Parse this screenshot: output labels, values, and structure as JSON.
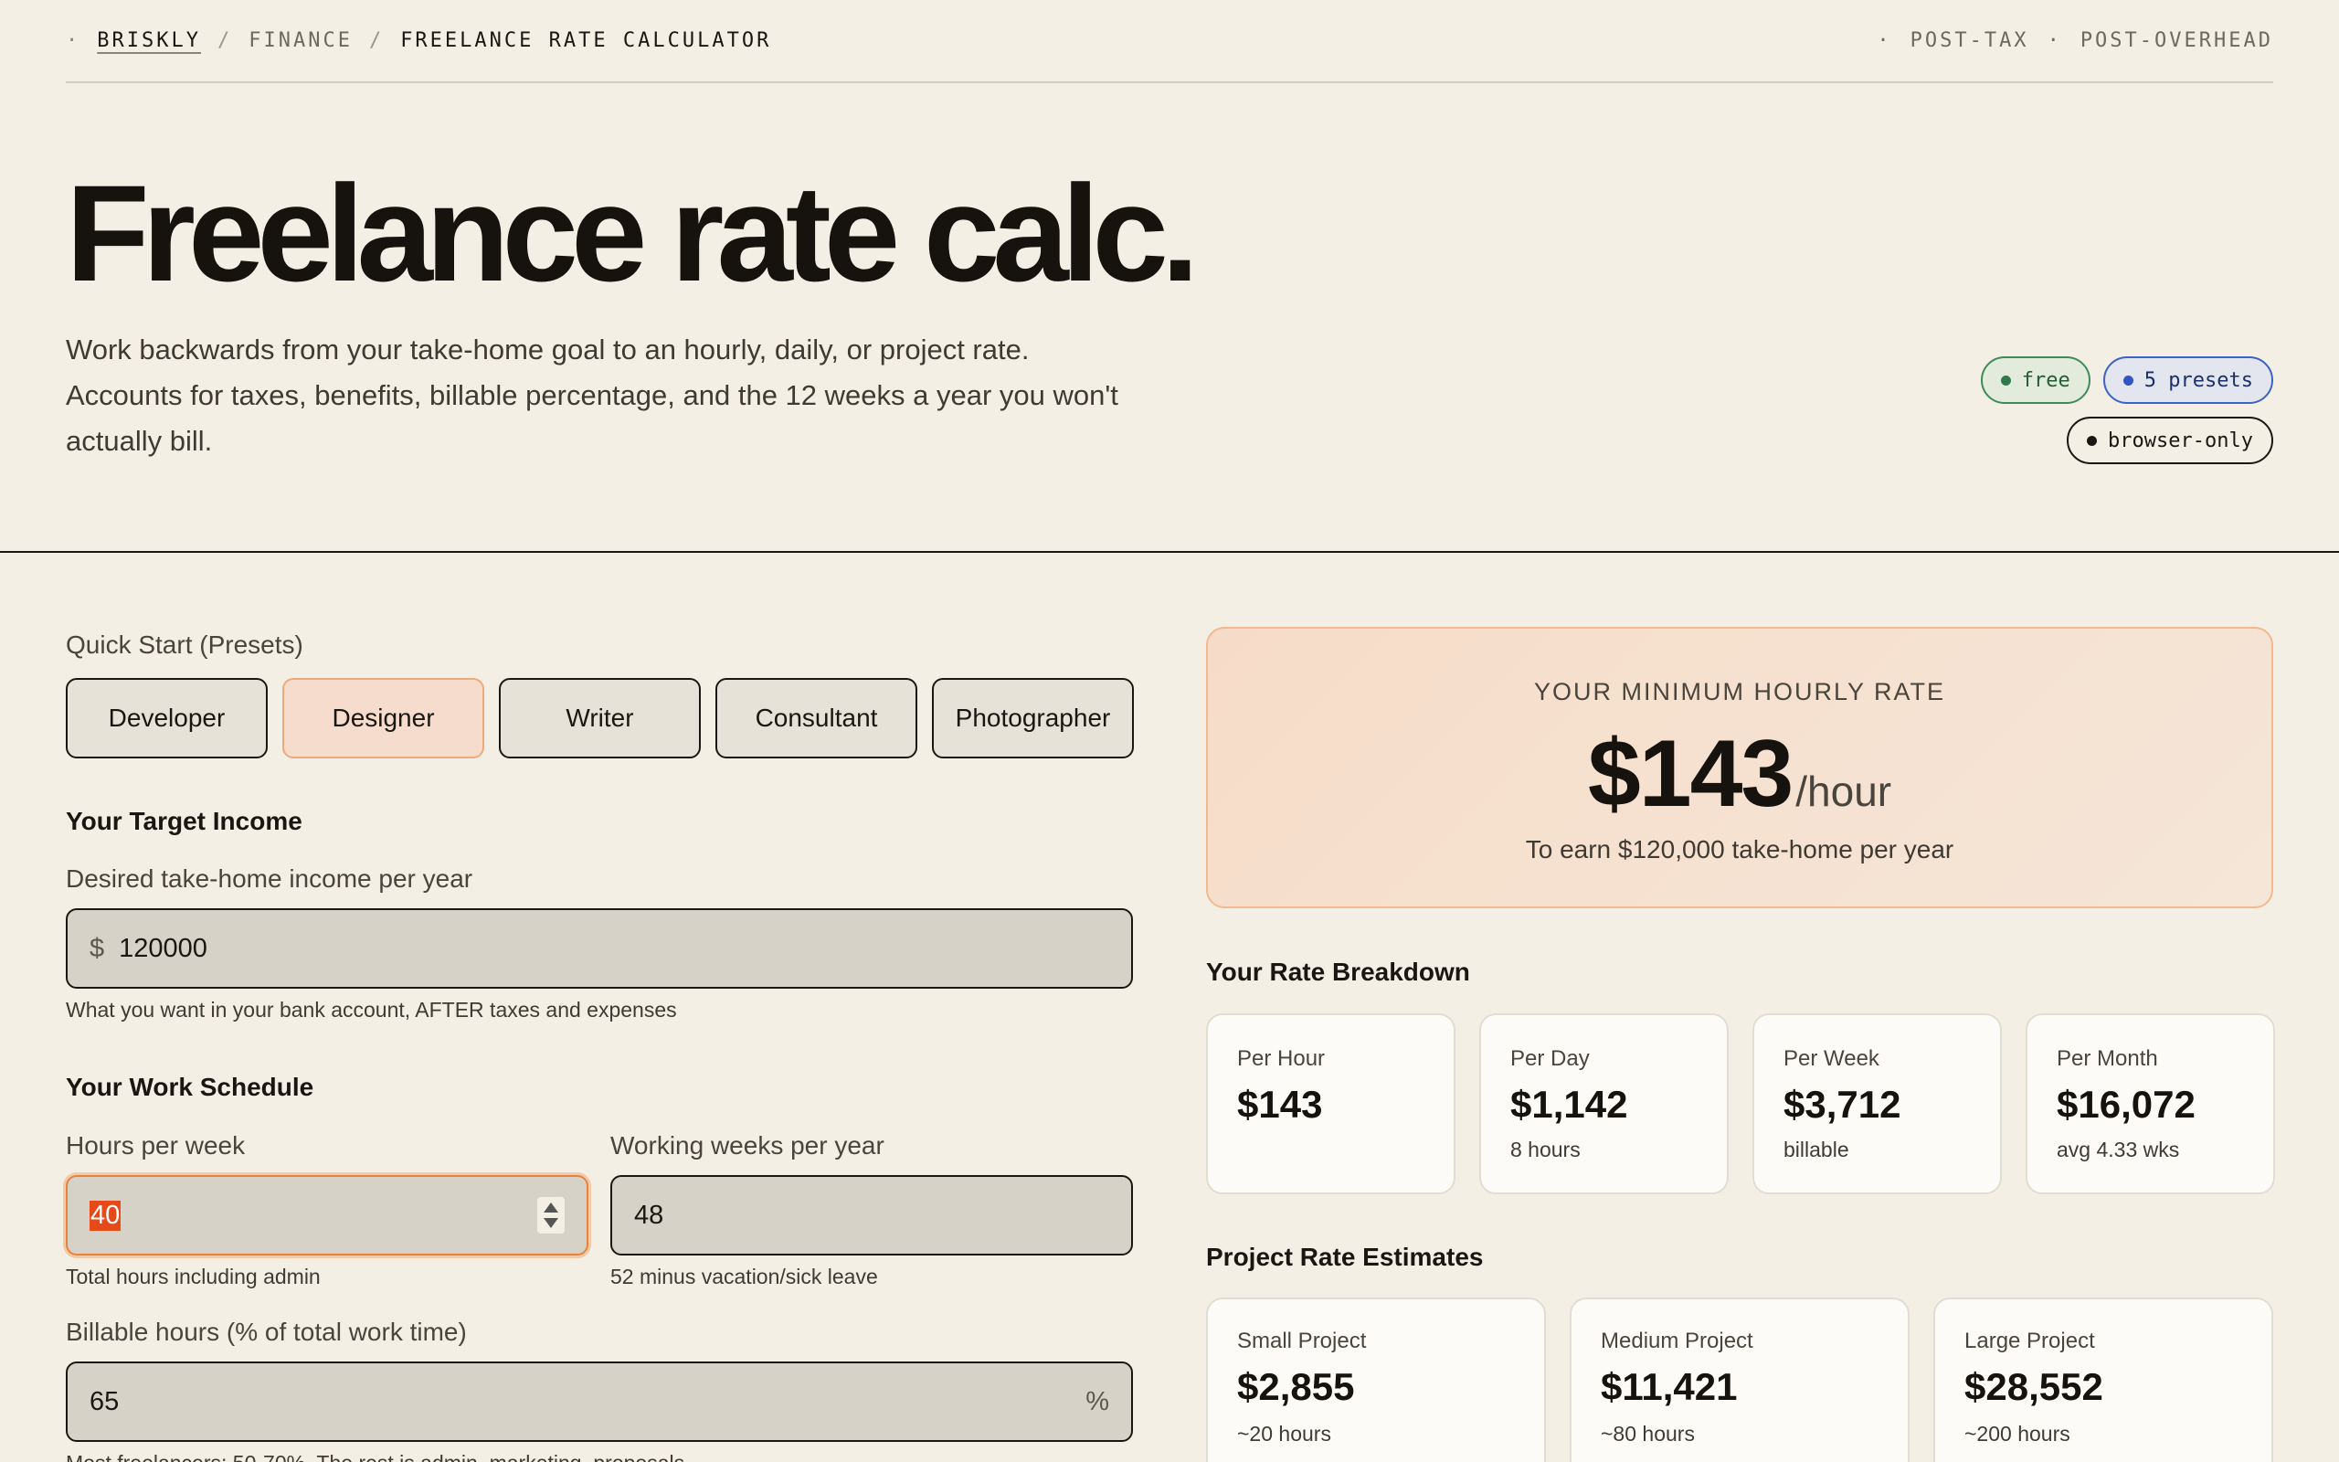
{
  "topbar": {
    "brand": "BRISKLY",
    "crumb2": "FINANCE",
    "current": "FREELANCE RATE CALCULATOR",
    "tag1": "POST-TAX",
    "tag2": "POST-OVERHEAD"
  },
  "hero": {
    "title": "Freelance rate calc.",
    "description": "Work backwards from your take-home goal to an hourly, daily, or project rate. Accounts for taxes, benefits, billable percentage, and the 12 weeks a year you won't actually bill.",
    "chips": [
      "free",
      "5 presets",
      "browser-only"
    ]
  },
  "presets": {
    "label": "Quick Start (Presets)",
    "items": [
      "Developer",
      "Designer",
      "Writer",
      "Consultant",
      "Photographer"
    ],
    "active": "Designer"
  },
  "income": {
    "heading": "Your Target Income",
    "label": "Desired take-home income per year",
    "prefix": "$",
    "value": "120000",
    "hint": "What you want in your bank account, AFTER taxes and expenses"
  },
  "schedule": {
    "heading": "Your Work Schedule",
    "hours_label": "Hours per week",
    "hours_value": "40",
    "hours_hint": "Total hours including admin",
    "weeks_label": "Working weeks per year",
    "weeks_value": "48",
    "weeks_hint": "52 minus vacation/sick leave",
    "billable_label": "Billable hours (% of total work time)",
    "billable_value": "65",
    "billable_suffix": "%",
    "billable_hint": "Most freelancers: 50-70%. The rest is admin, marketing, proposals"
  },
  "result": {
    "label": "YOUR MINIMUM HOURLY RATE",
    "value": "$143",
    "unit": "/hour",
    "sub": "To earn $120,000 take-home per year"
  },
  "breakdown": {
    "heading": "Your Rate Breakdown",
    "cards": [
      {
        "label": "Per Hour",
        "value": "$143",
        "note": ""
      },
      {
        "label": "Per Day",
        "value": "$1,142",
        "note": "8 hours"
      },
      {
        "label": "Per Week",
        "value": "$3,712",
        "note": "billable"
      },
      {
        "label": "Per Month",
        "value": "$16,072",
        "note": "avg 4.33 wks"
      }
    ]
  },
  "projects": {
    "heading": "Project Rate Estimates",
    "cards": [
      {
        "label": "Small Project",
        "value": "$2,855",
        "note": "~20 hours"
      },
      {
        "label": "Medium Project",
        "value": "$11,421",
        "note": "~80 hours"
      },
      {
        "label": "Large Project",
        "value": "$28,552",
        "note": "~200 hours"
      }
    ]
  }
}
